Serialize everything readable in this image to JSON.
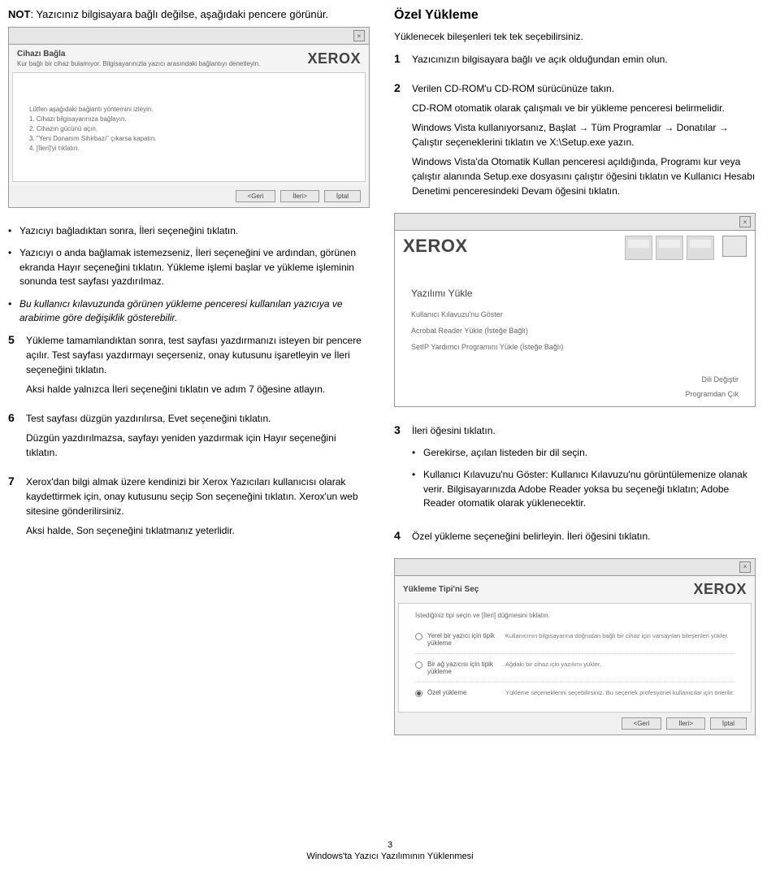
{
  "left": {
    "note_prefix": "NOT",
    "note_text": ": Yazıcınız bilgisayara bağlı değilse, aşağıdaki pencere görünür.",
    "dlg1": {
      "title": "Cihazı Bağla",
      "sub": "Kur bağlı bir cihaz bulamıyor. Bilgisayarınızla yazıcı arasındaki bağlantıyı denetleyin.",
      "xerox": "XEROX",
      "body_intro": "Lütfen aşağıdaki bağlantı yöntemini izleyin.",
      "body_1": "1. Cihazı bilgisayarınıza bağlayın.",
      "body_2": "2. Cihazın gücünü açın.",
      "body_3": "3. \"Yeni Donanım Sihirbazı\" çıkarsa kapatın.",
      "body_4": "4. [İleri]'yi tıklatın.",
      "back": "<Geri",
      "next": "İleri>",
      "cancel": "İptal"
    },
    "bul1": "Yazıcıyı bağladıktan sonra, İleri seçeneğini tıklatın.",
    "bul2_a": "Yazıcıyı o anda bağlamak istemezseniz, İleri seçeneğini ve ardından, görünen ekranda Hayır seçeneğini tıklatın. Yükleme işlemi başlar ve yükleme işleminin sonunda test sayfası yazdırılmaz.",
    "bul3": "Bu kullanıcı kılavuzunda görünen yükleme penceresi kullanılan yazıcıya ve arabirime göre değişiklik gösterebilir.",
    "s5_a": "Yükleme tamamlandıktan sonra, test sayfası yazdırmanızı isteyen bir pencere açılır. Test sayfası yazdırmayı seçerseniz, onay kutusunu işaretleyin ve İleri seçeneğini tıklatın.",
    "s5_b": "Aksi halde yalnızca İleri seçeneğini tıklatın ve adım 7 öğesine atlayın.",
    "s6_a": "Test sayfası düzgün yazdırılırsa, Evet seçeneğini tıklatın.",
    "s6_b": "Düzgün yazdırılmazsa, sayfayı yeniden yazdırmak için Hayır seçeneğini tıklatın.",
    "s7_a": "Xerox'dan bilgi almak üzere kendinizi bir Xerox Yazıcıları kullanıcısı olarak kaydettirmek için, onay kutusunu seçip Son seçeneğini tıklatın. Xerox'un web sitesine gönderilirsiniz.",
    "s7_b": "Aksi halde, Son seçeneğini tıklatmanız yeterlidir."
  },
  "right": {
    "heading": "Özel Yükleme",
    "intro": "Yüklenecek bileşenleri tek tek seçebilirsiniz.",
    "s1": "Yazıcınızın bilgisayara bağlı ve açık olduğundan emin olun.",
    "s2_a": "Verilen CD-ROM'u CD-ROM sürücünüze takın.",
    "s2_b": "CD-ROM otomatik olarak çalışmalı ve bir yükleme penceresi belirmelidir.",
    "s2_c": "Windows Vista kullanıyorsanız, Başlat → Tüm Programlar → Donatılar → Çalıştır seçeneklerini tıklatın ve X:\\Setup.exe yazın.",
    "s2_d": "Windows Vista'da Otomatik Kullan penceresi açıldığında, Programı kur veya çalıştır alanında Setup.exe dosyasını çalıştır öğesini tıklatın ve Kullanıcı Hesabı Denetimi penceresindeki Devam öğesini tıklatın.",
    "dlg2": {
      "xerox": "XEROX",
      "title": "Yazılımı Yükle",
      "l1": "Kullanıcı Kılavuzu'nu Göster",
      "l2": "Acrobat Reader Yükle (İsteğe Bağlı)",
      "l3": "SetIP Yardımcı Programını Yükle (İsteğe Bağlı)",
      "r1": "Dili Değiştir",
      "r2": "Programdan Çık"
    },
    "s3": "İleri öğesini tıklatın.",
    "s3_b1": "Gerekirse, açılan listeden bir dil seçin.",
    "s3_b2": "Kullanıcı Kılavuzu'nu Göster: Kullanıcı Kılavuzu'nu görüntülemenize olanak verir. Bilgisayarınızda Adobe Reader yoksa bu seçeneği tıklatın; Adobe Reader otomatik olarak yüklenecektir.",
    "s4": "Özel yükleme seçeneğini belirleyin. İleri öğesini tıklatın.",
    "dlg3": {
      "title": "Yükleme Tipi'ni Seç",
      "sub": "İstediğiniz tipi seçin ve [İleri] düğmesini tıklatın.",
      "r1_lbl": "Yerel bir yazıcı için tipik yükleme",
      "r1_desc": "Kullanıcının bilgisayarına doğrudan bağlı bir cihaz için varsayılan bileşenleri yükler.",
      "r2_lbl": "Bir ağ yazıcısı için tipik yükleme",
      "r2_desc": "Ağdaki bir cihaz için yazılımı yükler.",
      "r3_lbl": "Özel yükleme",
      "r3_desc": "Yükleme seçeneklerini seçebilirsiniz. Bu seçenek profesyonel kullanıcılar için önerilir.",
      "back": "<Geri",
      "next": "İleri>",
      "cancel": "İptal"
    }
  },
  "footer": {
    "page": "3",
    "title": "Windows'ta Yazıcı Yazılımının Yüklenmesi"
  }
}
